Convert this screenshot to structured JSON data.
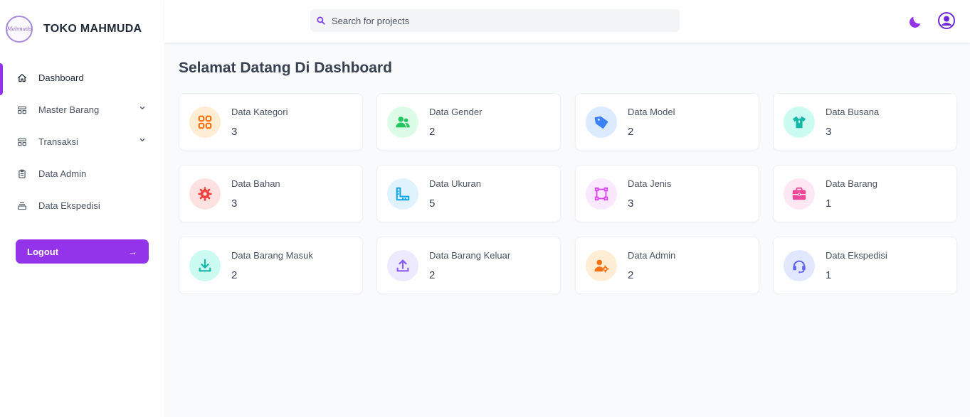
{
  "brand": {
    "name": "TOKO MAHMUDA",
    "logo_text": "Mahmuda"
  },
  "sidebar": {
    "items": [
      {
        "label": "Dashboard",
        "icon": "home-icon",
        "active": true
      },
      {
        "label": "Master Barang",
        "icon": "layout-icon",
        "has_dropdown": true
      },
      {
        "label": "Transaksi",
        "icon": "layout-icon",
        "has_dropdown": true
      },
      {
        "label": "Data Admin",
        "icon": "clipboard-icon"
      },
      {
        "label": "Data Ekspedisi",
        "icon": "box-icon"
      }
    ],
    "logout_label": "Logout",
    "logout_arrow": "→"
  },
  "header": {
    "search_placeholder": "Search for projects",
    "search_value": ""
  },
  "main": {
    "title": "Selamat Datang Di Dashboard",
    "cards": [
      {
        "name": "Data Kategori",
        "count": "3",
        "icon": "grid-icon",
        "color": "#f97316",
        "bg": "#ffedd5"
      },
      {
        "name": "Data Gender",
        "count": "2",
        "icon": "users-icon",
        "color": "#22c55e",
        "bg": "#dcfce7"
      },
      {
        "name": "Data Model",
        "count": "2",
        "icon": "tag-icon",
        "color": "#3b82f6",
        "bg": "#dbeafe"
      },
      {
        "name": "Data Busana",
        "count": "3",
        "icon": "shirt-icon",
        "color": "#14b8a6",
        "bg": "#ccfbf1"
      },
      {
        "name": "Data Bahan",
        "count": "3",
        "icon": "cog-icon",
        "color": "#ef4444",
        "bg": "#fee2e2"
      },
      {
        "name": "Data Ukuran",
        "count": "5",
        "icon": "ruler-icon",
        "color": "#0ea5e9",
        "bg": "#e0f2fe"
      },
      {
        "name": "Data Jenis",
        "count": "3",
        "icon": "vector-icon",
        "color": "#d946ef",
        "bg": "#fae8ff"
      },
      {
        "name": "Data Barang",
        "count": "1",
        "icon": "briefcase-icon",
        "color": "#ec4899",
        "bg": "#fce7f3"
      },
      {
        "name": "Data Barang Masuk",
        "count": "2",
        "icon": "download-icon",
        "color": "#14b8a6",
        "bg": "#ccfbf1"
      },
      {
        "name": "Data Barang Keluar",
        "count": "2",
        "icon": "upload-icon",
        "color": "#8b5cf6",
        "bg": "#ede9fe"
      },
      {
        "name": "Data Admin",
        "count": "2",
        "icon": "user-cog-icon",
        "color": "#f97316",
        "bg": "#ffedd5"
      },
      {
        "name": "Data Ekspedisi",
        "count": "1",
        "icon": "headset-icon",
        "color": "#6366f1",
        "bg": "#e0e7ff"
      }
    ]
  },
  "colors": {
    "accent": "#9333ea"
  }
}
